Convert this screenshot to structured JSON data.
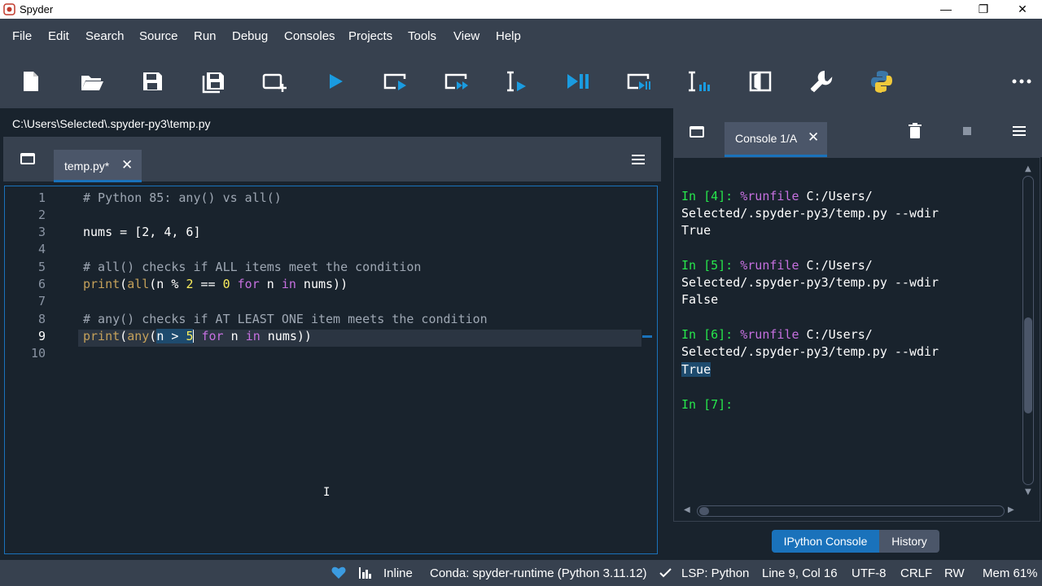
{
  "window": {
    "title": "Spyder",
    "minimize": "—",
    "restore": "❐",
    "close": "✕"
  },
  "menu": [
    "File",
    "Edit",
    "Search",
    "Source",
    "Run",
    "Debug",
    "Consoles",
    "Projects",
    "Tools",
    "View",
    "Help"
  ],
  "editor": {
    "path": "C:\\Users\\Selected\\.spyder-py3\\temp.py",
    "tab_label": "temp.py*",
    "tab_close": "✕",
    "line_numbers": [
      "1",
      "2",
      "3",
      "4",
      "5",
      "6",
      "7",
      "8",
      "9",
      "10"
    ],
    "current_line": "9",
    "lines": {
      "l1": "# Python 85: any() vs all()",
      "l3": "nums = [2, 4, 6]",
      "l5": "# all() checks if ALL items meet the condition",
      "l8": "# any() checks if AT LEAST ONE item meets the condition"
    },
    "l6": {
      "print": "print",
      "p1": "(",
      "all": "all",
      "p2": "(n % ",
      "n2": "2",
      "eq": " == ",
      "n0": "0",
      "sp1": " ",
      "for": "for",
      "mid": " n ",
      "in": "in",
      "end": " nums))"
    },
    "l9": {
      "print": "print",
      "p1": "(",
      "any": "any",
      "paren": "(",
      "sel": "n > ",
      "n5": "5",
      "sp": " ",
      "for": "for",
      "mid": " n ",
      "in": "in",
      "end": " nums))"
    },
    "ibeam": "I"
  },
  "console": {
    "tab_label": "Console 1/A",
    "tab_close": "✕",
    "entries": [
      {
        "prompt": "In [4]: ",
        "magic": "%runfile",
        "cmd": " C:/Users/",
        "cmd2": "Selected/.spyder-py3/temp.py --wdir",
        "output": "True"
      },
      {
        "prompt": "In [5]: ",
        "magic": "%runfile",
        "cmd": " C:/Users/",
        "cmd2": "Selected/.spyder-py3/temp.py --wdir",
        "output": "False"
      },
      {
        "prompt": "In [6]: ",
        "magic": "%runfile",
        "cmd": " C:/Users/",
        "cmd2": "Selected/.spyder-py3/temp.py --wdir",
        "output": "True"
      }
    ],
    "current_prompt": "In [7]:",
    "bottom_tabs": {
      "active": "IPython Console",
      "inactive": "History"
    }
  },
  "statusbar": {
    "inline": "Inline",
    "conda": "Conda: spyder-runtime (Python 3.11.12)",
    "lsp": "LSP: Python",
    "position": "Line 9, Col 16",
    "encoding": "UTF-8",
    "eol": "CRLF",
    "perm": "RW",
    "mem": "Mem 61%"
  },
  "colors": {
    "accent": "#1a72bb",
    "background": "#19232d",
    "panel": "#37414f",
    "prompt": "#27e74c",
    "keyword": "#c670e0",
    "number": "#faed5c"
  }
}
